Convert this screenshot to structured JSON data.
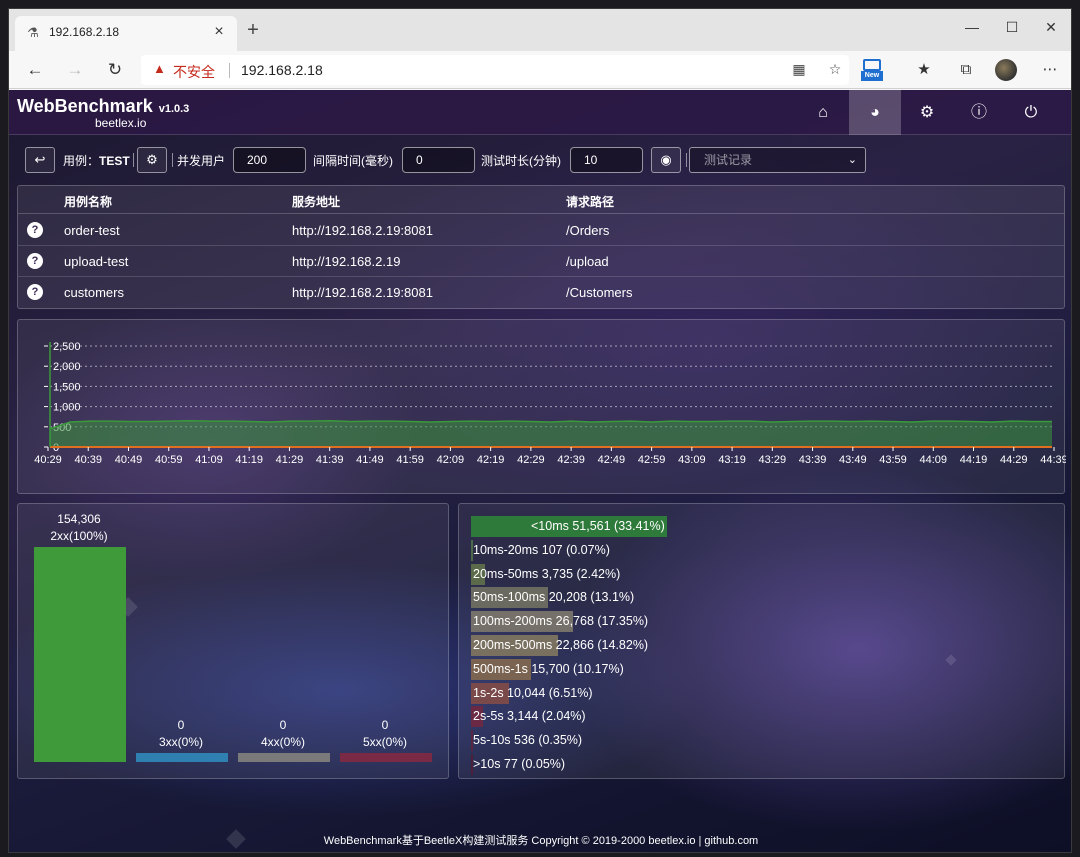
{
  "browser": {
    "tab_title": "192.168.2.18",
    "new_tab_label": "+",
    "security_warning": "不安全",
    "url": "192.168.2.18",
    "new_badge": "New"
  },
  "app": {
    "name": "WebBenchmark",
    "version": "v1.0.3",
    "subtitle": "beetlex.io",
    "nav": [
      "home-icon",
      "dashboard-icon",
      "gear-icon",
      "help-icon",
      "power-icon"
    ]
  },
  "toolbar": {
    "case_prefix": "用例：",
    "case_name": "TEST",
    "concurrent_label": "并发用户",
    "concurrent_value": "200",
    "interval_label": "间隔时间(毫秒)",
    "interval_value": "0",
    "duration_label": "测试时长(分钟)",
    "duration_value": "10",
    "records_placeholder": "测试记录"
  },
  "cases": {
    "headers": [
      "用例名称",
      "服务地址",
      "请求路径"
    ],
    "rows": [
      {
        "name": "order-test",
        "server": "http://192.168.2.19:8081",
        "path": "/Orders"
      },
      {
        "name": "upload-test",
        "server": "http://192.168.2.19",
        "path": "/upload"
      },
      {
        "name": "customers",
        "server": "http://192.168.2.19:8081",
        "path": "/Customers"
      }
    ]
  },
  "chart_data": [
    {
      "type": "area",
      "title": "",
      "ylim": [
        0,
        2500
      ],
      "yticks": [
        0,
        500,
        1000,
        1500,
        2000,
        2500
      ],
      "ytick_labels": [
        "0",
        "500",
        "1,000",
        "1,500",
        "2,000",
        "2,500"
      ],
      "x_tick_labels": [
        "40:29",
        "40:39",
        "40:49",
        "40:59",
        "41:09",
        "41:19",
        "41:29",
        "41:39",
        "41:49",
        "41:59",
        "42:09",
        "42:19",
        "42:29",
        "42:39",
        "42:49",
        "42:59",
        "43:09",
        "43:19",
        "43:29",
        "43:39",
        "43:49",
        "43:59",
        "44:09",
        "44:19",
        "44:29",
        "44:39"
      ],
      "grid": true,
      "series": [
        {
          "color": "#3a9a3a",
          "values": [
            450,
            620,
            640,
            640,
            630,
            630,
            640,
            650,
            640,
            640,
            630,
            620,
            640,
            640,
            650,
            630,
            640,
            640,
            630,
            620,
            630,
            640,
            630,
            640,
            630,
            620,
            640,
            620,
            630,
            640,
            620,
            640,
            630,
            630,
            640,
            640,
            620,
            630,
            640,
            640,
            630,
            640,
            630,
            620,
            640,
            640,
            630,
            620,
            640,
            630,
            630
          ]
        },
        {
          "color": "#e07020",
          "values": [
            0,
            0,
            0,
            0,
            0,
            0,
            0,
            0,
            0,
            0,
            0,
            0,
            0,
            0,
            0,
            0,
            0,
            0,
            0,
            0,
            0,
            0,
            0,
            0,
            0,
            0,
            0,
            0,
            0,
            0,
            0,
            0,
            0,
            0,
            0,
            0,
            0,
            0,
            0,
            0,
            0,
            0,
            0,
            0,
            0,
            0,
            0,
            0,
            0,
            0,
            0
          ]
        }
      ]
    },
    {
      "type": "bar",
      "categories": [
        "2xx(100%)",
        "3xx(0%)",
        "4xx(0%)",
        "5xx(0%)"
      ],
      "values": [
        154306,
        0,
        0,
        0
      ],
      "value_labels": [
        "154,306",
        "0",
        "0",
        "0"
      ],
      "colors": [
        "#3f9a3a",
        "#2f7fb0",
        "#7a7a7a",
        "#7a2a45"
      ]
    },
    {
      "type": "bar",
      "orientation": "horizontal",
      "categories": [
        "<10ms",
        "10ms-20ms",
        "20ms-50ms",
        "50ms-100ms",
        "100ms-200ms",
        "200ms-500ms",
        "500ms-1s",
        "1s-2s",
        "2s-5s",
        "5s-10s",
        ">10s"
      ],
      "values": [
        51561,
        107,
        3735,
        20208,
        26768,
        22866,
        15700,
        10044,
        3144,
        536,
        77
      ],
      "labels": [
        "<10ms 51,561 (33.41%)",
        "10ms-20ms 107 (0.07%)",
        "20ms-50ms 3,735 (2.42%)",
        "50ms-100ms 20,208 (13.1%)",
        "100ms-200ms 26,768 (17.35%)",
        "200ms-500ms 22,866 (14.82%)",
        "500ms-1s 15,700 (10.17%)",
        "1s-2s 10,044 (6.51%)",
        "2s-5s 3,144 (2.04%)",
        "5s-10s 536 (0.35%)",
        ">10s 77 (0.05%)"
      ],
      "percents": [
        33.41,
        0.07,
        2.42,
        13.1,
        17.35,
        14.82,
        10.17,
        6.51,
        2.04,
        0.35,
        0.05
      ],
      "colors": [
        "#2e7a3a",
        "#4a6a4a",
        "#5a6a4a",
        "#6a6a60",
        "#75706a",
        "#7a7060",
        "#7a6350",
        "#7a4a4a",
        "#6a2a45",
        "#5a2540",
        "#4a2038"
      ]
    }
  ],
  "footer": "WebBenchmark基于BeetleX构建测试服务 Copyright © 2019-2000 beetlex.io | github.com"
}
